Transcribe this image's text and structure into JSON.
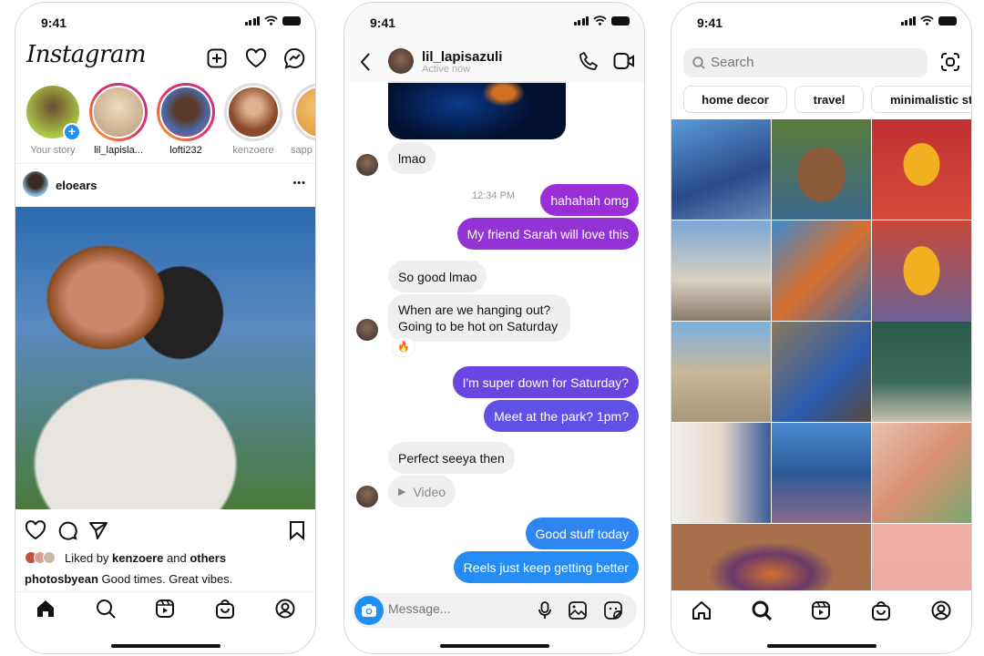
{
  "status_time": "9:41",
  "feed": {
    "logo": "Instagram",
    "icons": [
      "new-post-icon",
      "heart-icon",
      "messenger-icon"
    ],
    "stories": [
      {
        "name": "Your story",
        "ring": "none",
        "color": "#7a5a3a"
      },
      {
        "name": "lil_lapisla...",
        "ring": "active",
        "color": "#d9c7a8"
      },
      {
        "name": "lofti232",
        "ring": "active",
        "color": "#4a6aa8"
      },
      {
        "name": "kenzoere",
        "ring": "seen",
        "color": "#8a4a2a"
      },
      {
        "name": "sapp",
        "ring": "seen",
        "color": "#e0a040"
      }
    ],
    "post": {
      "username": "eloears",
      "more": "•••",
      "liked_prefix": "Liked by ",
      "liked_user": "kenzoere",
      "liked_and": " and ",
      "liked_others": "others",
      "caption_user": "photosbyean",
      "caption_text": " Good times. Great vibes."
    }
  },
  "chat": {
    "username": "lil_lapisazuli",
    "status": "Active now",
    "messages": [
      {
        "side": "recv",
        "text": "lmao"
      },
      {
        "side": "meta",
        "text": "12:34 PM"
      },
      {
        "side": "sent",
        "text": "hahahah omg",
        "color": "#9a2fd8"
      },
      {
        "side": "sent",
        "text": "My friend Sarah will love this",
        "color": "#9333d6"
      },
      {
        "side": "recv",
        "text": "So good lmao"
      },
      {
        "side": "recv",
        "text": "When are we hanging out?",
        "text2": "Going to be hot on Saturday"
      },
      {
        "side": "reaction",
        "text": "🔥"
      },
      {
        "side": "sent",
        "text": "I'm super down for Saturday?",
        "color": "#6a45e0"
      },
      {
        "side": "sent",
        "text": "Meet at the park? 1pm?",
        "color": "#6150e6"
      },
      {
        "side": "recv",
        "text": "Perfect seeya then"
      },
      {
        "side": "recv",
        "text": "Video"
      },
      {
        "side": "sent",
        "text": "Good stuff today",
        "color": "#2f86f2"
      },
      {
        "side": "sent",
        "text": "Reels just keep getting better",
        "color": "#258cf4"
      }
    ],
    "composer_placeholder": "Message...",
    "accent": "#1e90f0"
  },
  "explore": {
    "search_placeholder": "Search",
    "chips": [
      "home decor",
      "travel",
      "minimalistic sty"
    ]
  },
  "nav": [
    "home-icon",
    "search-icon",
    "reels-icon",
    "shop-icon",
    "profile-icon"
  ]
}
